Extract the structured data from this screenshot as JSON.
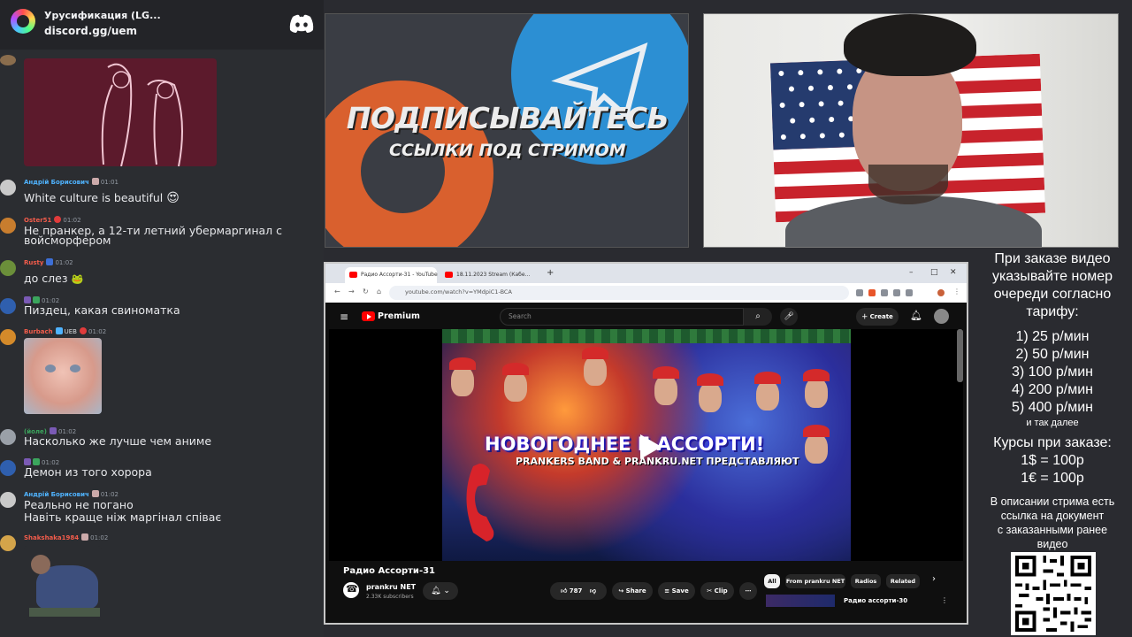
{
  "discord": {
    "server_name": "Урусификация (LG...",
    "invite_link": "discord.gg/uem",
    "messages": [
      {
        "author": "Андрій Борисович",
        "author_color": "#4fb3ff",
        "time": "01:01",
        "text": "White culture is beautiful",
        "emoji": "😍"
      },
      {
        "author": "Oster51",
        "author_color": "#f25c4b",
        "time": "01:02",
        "lines": [
          "Не пранкер, а 12-ти летний убермаргинал с",
          "войсморфером"
        ]
      },
      {
        "author": "Rusty",
        "author_color": "#f25c4b",
        "time": "01:02",
        "text": "до слез",
        "emoji": "🐸"
      },
      {
        "author": "",
        "time": "01:02",
        "text": "Пиздец, какая свиноматка"
      },
      {
        "author": "Burbach",
        "author_color": "#f25c4b",
        "badge": "UEB",
        "time": "01:02"
      },
      {
        "author": "(йоле)",
        "author_color": "#3ba55d",
        "time": "01:02",
        "text": "Насколько же лучше чем аниме"
      },
      {
        "author": "",
        "time": "01:02",
        "text": "Демон из того хорора"
      },
      {
        "author": "Андрій Борисович",
        "author_color": "#4fb3ff",
        "time": "01:02",
        "lines": [
          "Реально не погано",
          "Навіть краще ніж маргінал співає"
        ]
      },
      {
        "author": "Shakshaka1984",
        "author_color": "#f25c4b",
        "time": "01:02"
      }
    ]
  },
  "promo": {
    "title": "ПОДПИСЫВАЙТЕСЬ",
    "subtitle": "ССЫЛКИ ПОД СТРИМОМ"
  },
  "order_info": {
    "heading_lines": [
      "При заказе видео",
      "указывайте номер",
      "очереди согласно",
      "тарифу:"
    ],
    "tariffs": [
      "1) 25 р/мин",
      "2) 50 р/мин",
      "3) 100 р/мин",
      "4) 200 р/мин",
      "5) 400 р/мин"
    ],
    "tariff_more": "и так далее",
    "rates_heading": "Курсы при заказе:",
    "rates": [
      "1$ = 100р",
      "1€ = 100р"
    ],
    "note_lines": [
      "В описании стрима есть",
      "ссылка на документ",
      "с заказанными ранее",
      "видео"
    ]
  },
  "browser": {
    "tabs": [
      "Радио Ассорти-31 - YouTube",
      "18.11.2023 Stream (Кабе..."
    ],
    "url": "youtube.com/watch?v=YMdpiC1-BCA"
  },
  "youtube": {
    "brand": "Premium",
    "search_placeholder": "Search",
    "create_label": "Create",
    "thumbnail_title": "НОВОГОДНЕЕ     Е АССОРТИ!",
    "thumbnail_subtitle": "PRANKERS BAND & PRANKRU.NET ПРЕДСТАВЛЯЮТ",
    "video_title": "Радио Ассорти-31",
    "channel_name": "prankru NET",
    "subscribers": "2.33K subscribers",
    "likes": "787",
    "share_label": "Share",
    "save_label": "Save",
    "clip_label": "Clip",
    "chips": [
      "All",
      "From prankru NET",
      "Radios",
      "Related"
    ],
    "recommended_title": "Радио ассорти-30"
  }
}
